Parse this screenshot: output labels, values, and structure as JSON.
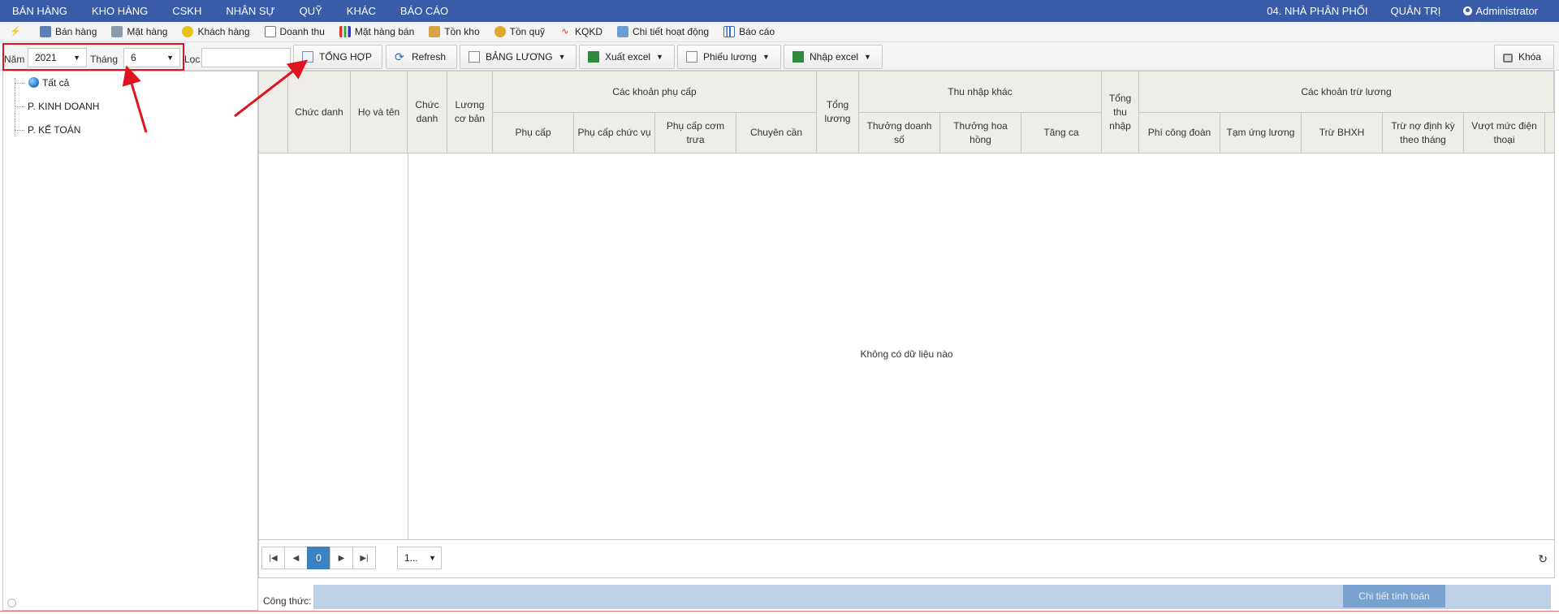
{
  "topnav": {
    "menu": [
      "BÁN HÀNG",
      "KHO HÀNG",
      "CSKH",
      "NHÂN SỰ",
      "QUỸ",
      "KHÁC",
      "BÁO CÁO"
    ],
    "branch": "04. NHÀ PHÂN PHỐI",
    "admin": "QUẢN TRỊ",
    "user": "Administrator"
  },
  "quickbar": [
    {
      "label": "Bán hàng",
      "icon": "sale-icon"
    },
    {
      "label": "Mặt hàng",
      "icon": "product-icon"
    },
    {
      "label": "Khách hàng",
      "icon": "customer-icon"
    },
    {
      "label": "Doanh thu",
      "icon": "revenue-icon"
    },
    {
      "label": "Mặt hàng bán",
      "icon": "chart-icon"
    },
    {
      "label": "Tồn kho",
      "icon": "stock-icon"
    },
    {
      "label": "Tồn quỹ",
      "icon": "coins-icon"
    },
    {
      "label": "KQKD",
      "icon": "pulse-icon"
    },
    {
      "label": "Chi tiết hoạt động",
      "icon": "activity-icon"
    },
    {
      "label": "Báo cáo",
      "icon": "report-icon"
    }
  ],
  "filters": {
    "year_label": "Năm",
    "year_value": "2021",
    "month_label": "Tháng",
    "month_value": "6",
    "filter_label": "Lọc",
    "filter_value": ""
  },
  "buttons": {
    "tong_hop": "TỔNG HỢP",
    "refresh": "Refresh",
    "bang_luong": "BẢNG LƯƠNG",
    "xuat_excel": "Xuất excel",
    "phieu_luong": "Phiếu lương",
    "nhap_excel": "Nhập excel",
    "khoa": "Khóa"
  },
  "tree": {
    "root": "Tất cả",
    "children": [
      "P. KINH DOANH",
      "P. KẾ TOÁN"
    ]
  },
  "grid": {
    "headers": {
      "chuc_danh_1": "Chức danh",
      "ho_va_ten": "Họ và tên",
      "chuc_danh_2": "Chức danh",
      "luong_co_ban": "Lương cơ bản",
      "phu_cap_group": "Các khoản phụ cấp",
      "phu_cap": "Phụ cấp",
      "phu_cap_chuc_vu": "Phụ cấp chức vụ",
      "phu_cap_com_trua": "Phụ cấp cơm trưa",
      "chuyen_can": "Chuyên cần",
      "tong_luong": "Tổng lương",
      "thu_nhap_khac_group": "Thu nhập khác",
      "thuong_doanh_so": "Thưởng doanh số",
      "thuong_hoa_hong": "Thưởng hoa hồng",
      "tang_ca": "Tăng ca",
      "tong_thu_nhap": "Tổng thu nhập",
      "tru_luong_group": "Các khoản trừ lương",
      "phi_cong_doan": "Phí công đoàn",
      "tam_ung_luong": "Tạm ứng lương",
      "tru_bhxh": "Trừ BHXH",
      "tru_no_dinh_ky": "Trừ nợ định kỳ theo tháng",
      "vuot_muc_dien_thoai": "Vượt mức điện thoại"
    },
    "empty_message": "Không có dữ liệu nào"
  },
  "pager": {
    "current_page": "0",
    "page_size": "1..."
  },
  "formula": {
    "label": "Công thức:",
    "calc_button": "Chi tiết tính toán"
  },
  "colors": {
    "nav_bg": "#3a5ba7",
    "highlight": "#e0141e",
    "pager_active": "#3b82c4"
  }
}
